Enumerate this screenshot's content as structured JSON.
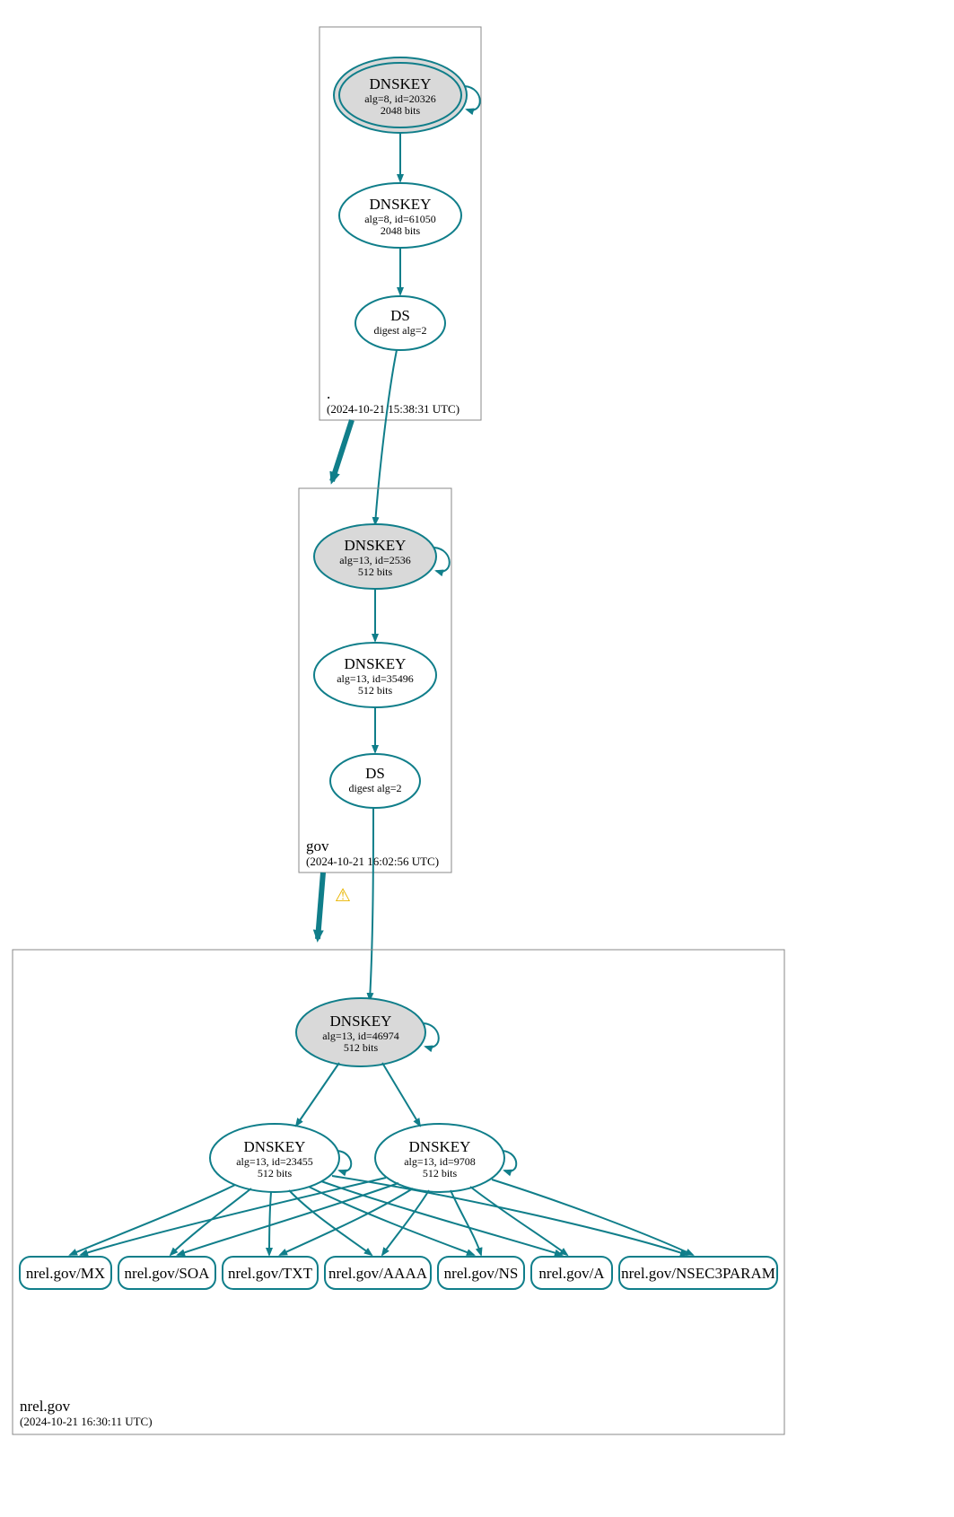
{
  "zones": {
    "root": {
      "name": ".",
      "timestamp": "(2024-10-21 15:38:31 UTC)"
    },
    "gov": {
      "name": "gov",
      "timestamp": "(2024-10-21 16:02:56 UTC)"
    },
    "nrel": {
      "name": "nrel.gov",
      "timestamp": "(2024-10-21 16:30:11 UTC)"
    }
  },
  "nodes": {
    "root_ksk": {
      "title": "DNSKEY",
      "line1": "alg=8, id=20326",
      "line2": "2048 bits"
    },
    "root_zsk": {
      "title": "DNSKEY",
      "line1": "alg=8, id=61050",
      "line2": "2048 bits"
    },
    "root_ds": {
      "title": "DS",
      "line1": "digest alg=2"
    },
    "gov_ksk": {
      "title": "DNSKEY",
      "line1": "alg=13, id=2536",
      "line2": "512 bits"
    },
    "gov_zsk": {
      "title": "DNSKEY",
      "line1": "alg=13, id=35496",
      "line2": "512 bits"
    },
    "gov_ds": {
      "title": "DS",
      "line1": "digest alg=2"
    },
    "nrel_ksk": {
      "title": "DNSKEY",
      "line1": "alg=13, id=46974",
      "line2": "512 bits"
    },
    "nrel_zsk_a": {
      "title": "DNSKEY",
      "line1": "alg=13, id=23455",
      "line2": "512 bits"
    },
    "nrel_zsk_b": {
      "title": "DNSKEY",
      "line1": "alg=13, id=9708",
      "line2": "512 bits"
    }
  },
  "rrsets": {
    "mx": "nrel.gov/MX",
    "soa": "nrel.gov/SOA",
    "txt": "nrel.gov/TXT",
    "aaaa": "nrel.gov/AAAA",
    "ns": "nrel.gov/NS",
    "a": "nrel.gov/A",
    "nsec3": "nrel.gov/NSEC3PARAM"
  },
  "icons": {
    "warning": "⚠"
  }
}
